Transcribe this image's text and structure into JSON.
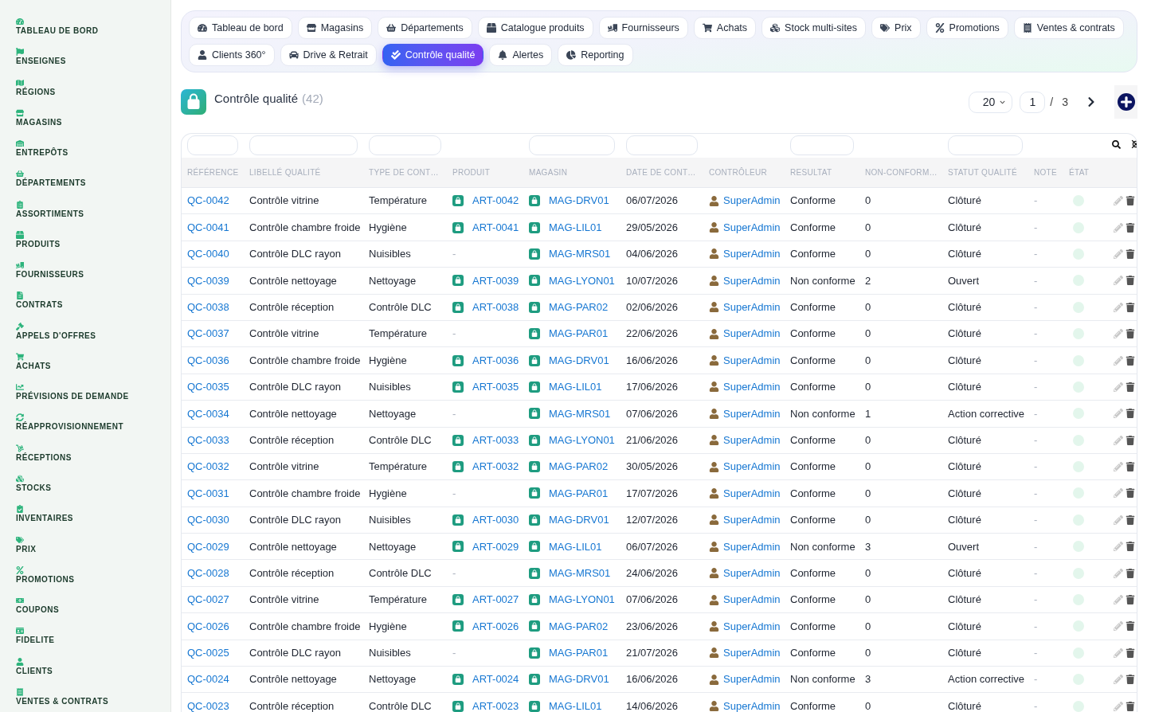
{
  "sidebar": {
    "items": [
      {
        "label": "TABLEAU DE BORD"
      },
      {
        "label": "ENSEIGNES"
      },
      {
        "label": "RÉGIONS"
      },
      {
        "label": "MAGASINS"
      },
      {
        "label": "ENTREPÔTS"
      },
      {
        "label": "DÉPARTEMENTS"
      },
      {
        "label": "ASSORTIMENTS"
      },
      {
        "label": "PRODUITS"
      },
      {
        "label": "FOURNISSEURS"
      },
      {
        "label": "CONTRATS"
      },
      {
        "label": "APPELS D'OFFRES"
      },
      {
        "label": "ACHATS"
      },
      {
        "label": "PRÉVISIONS DE DEMANDE"
      },
      {
        "label": "RÉAPPROVISIONNEMENT"
      },
      {
        "label": "RÉCEPTIONS"
      },
      {
        "label": "STOCKS"
      },
      {
        "label": "INVENTAIRES"
      },
      {
        "label": "PRIX"
      },
      {
        "label": "PROMOTIONS"
      },
      {
        "label": "COUPONS"
      },
      {
        "label": "FIDELITE"
      },
      {
        "label": "CLIENTS"
      },
      {
        "label": "VENTES & CONTRATS"
      }
    ]
  },
  "tab_rows": [
    [
      {
        "label": "Tableau de bord",
        "selected": false
      },
      {
        "label": "Magasins",
        "selected": false
      },
      {
        "label": "Départements",
        "selected": false
      },
      {
        "label": "Catalogue produits",
        "selected": false
      },
      {
        "label": "Fournisseurs",
        "selected": false
      },
      {
        "label": "Achats",
        "selected": false
      },
      {
        "label": "Stock multi-sites",
        "selected": false
      },
      {
        "label": "Prix",
        "selected": false
      },
      {
        "label": "Promotions",
        "selected": false
      },
      {
        "label": "Ventes & contrats",
        "selected": false
      }
    ],
    [
      {
        "label": "Clients 360°",
        "selected": false
      },
      {
        "label": "Drive & Retrait",
        "selected": false
      },
      {
        "label": "Contrôle qualité",
        "selected": true
      },
      {
        "label": "Alertes",
        "selected": false
      },
      {
        "label": "Reporting",
        "selected": false
      }
    ]
  ],
  "page_header": {
    "title": "Contrôle qualité",
    "count": "(42)"
  },
  "pagination": {
    "page_size": "20",
    "page": "1",
    "separator": "/",
    "total_pages": "3"
  },
  "table": {
    "columns": [
      {
        "label": "RÉFÉRENCE",
        "has_filter": true
      },
      {
        "label": "LIBELLÉ QUALITÉ",
        "has_filter": true
      },
      {
        "label": "TYPE DE CONT…",
        "has_filter": true
      },
      {
        "label": "PRODUIT",
        "has_filter": false
      },
      {
        "label": "MAGASIN",
        "has_filter": true
      },
      {
        "label": "DATE DE CONT…",
        "has_filter": true
      },
      {
        "label": "CONTRÔLEUR",
        "has_filter": false
      },
      {
        "label": "RESULTAT",
        "has_filter": true
      },
      {
        "label": "NON-CONFORM…",
        "has_filter": false
      },
      {
        "label": "STATUT QUALITÉ",
        "has_filter": true
      },
      {
        "label": "NOTE",
        "has_filter": false
      },
      {
        "label": "ÉTAT",
        "has_filter": false
      }
    ],
    "rows": [
      {
        "reference": "QC-0042",
        "libelle": "Contrôle vitrine",
        "type": "Température",
        "produit": {
          "kind": "link",
          "text": "ART-0042"
        },
        "magasin": "MAG-DRV01",
        "date": "06/07/2026",
        "controleur": "SuperAdmin",
        "resultat": "Conforme",
        "non_conformites": "0",
        "statut": "Clôturé",
        "note": "-"
      },
      {
        "reference": "QC-0041",
        "libelle": "Contrôle chambre froide",
        "type": "Hygiène",
        "produit": {
          "kind": "link",
          "text": "ART-0041"
        },
        "magasin": "MAG-LIL01",
        "date": "29/05/2026",
        "controleur": "SuperAdmin",
        "resultat": "Conforme",
        "non_conformites": "0",
        "statut": "Clôturé",
        "note": "-"
      },
      {
        "reference": "QC-0040",
        "libelle": "Contrôle DLC rayon",
        "type": "Nuisibles",
        "produit": {
          "kind": "empty",
          "text": "-"
        },
        "magasin": "MAG-MRS01",
        "date": "04/06/2026",
        "controleur": "SuperAdmin",
        "resultat": "Conforme",
        "non_conformites": "0",
        "statut": "Clôturé",
        "note": "-"
      },
      {
        "reference": "QC-0039",
        "libelle": "Contrôle nettoyage",
        "type": "Nettoyage",
        "produit": {
          "kind": "link",
          "text": "ART-0039"
        },
        "magasin": "MAG-LYON01",
        "date": "10/07/2026",
        "controleur": "SuperAdmin",
        "resultat": "Non conforme",
        "non_conformites": "2",
        "statut": "Ouvert",
        "note": "-"
      },
      {
        "reference": "QC-0038",
        "libelle": "Contrôle réception",
        "type": "Contrôle DLC",
        "produit": {
          "kind": "link",
          "text": "ART-0038"
        },
        "magasin": "MAG-PAR02",
        "date": "02/06/2026",
        "controleur": "SuperAdmin",
        "resultat": "Conforme",
        "non_conformites": "0",
        "statut": "Clôturé",
        "note": "-"
      },
      {
        "reference": "QC-0037",
        "libelle": "Contrôle vitrine",
        "type": "Température",
        "produit": {
          "kind": "empty",
          "text": "-"
        },
        "magasin": "MAG-PAR01",
        "date": "22/06/2026",
        "controleur": "SuperAdmin",
        "resultat": "Conforme",
        "non_conformites": "0",
        "statut": "Clôturé",
        "note": "-"
      },
      {
        "reference": "QC-0036",
        "libelle": "Contrôle chambre froide",
        "type": "Hygiène",
        "produit": {
          "kind": "link",
          "text": "ART-0036"
        },
        "magasin": "MAG-DRV01",
        "date": "16/06/2026",
        "controleur": "SuperAdmin",
        "resultat": "Conforme",
        "non_conformites": "0",
        "statut": "Clôturé",
        "note": "-"
      },
      {
        "reference": "QC-0035",
        "libelle": "Contrôle DLC rayon",
        "type": "Nuisibles",
        "produit": {
          "kind": "link",
          "text": "ART-0035"
        },
        "magasin": "MAG-LIL01",
        "date": "17/06/2026",
        "controleur": "SuperAdmin",
        "resultat": "Conforme",
        "non_conformites": "0",
        "statut": "Clôturé",
        "note": "-"
      },
      {
        "reference": "QC-0034",
        "libelle": "Contrôle nettoyage",
        "type": "Nettoyage",
        "produit": {
          "kind": "empty",
          "text": "-"
        },
        "magasin": "MAG-MRS01",
        "date": "07/06/2026",
        "controleur": "SuperAdmin",
        "resultat": "Non conforme",
        "non_conformites": "1",
        "statut": "Action corrective",
        "note": "-"
      },
      {
        "reference": "QC-0033",
        "libelle": "Contrôle réception",
        "type": "Contrôle DLC",
        "produit": {
          "kind": "link",
          "text": "ART-0033"
        },
        "magasin": "MAG-LYON01",
        "date": "21/06/2026",
        "controleur": "SuperAdmin",
        "resultat": "Conforme",
        "non_conformites": "0",
        "statut": "Clôturé",
        "note": "-"
      },
      {
        "reference": "QC-0032",
        "libelle": "Contrôle vitrine",
        "type": "Température",
        "produit": {
          "kind": "link",
          "text": "ART-0032"
        },
        "magasin": "MAG-PAR02",
        "date": "30/05/2026",
        "controleur": "SuperAdmin",
        "resultat": "Conforme",
        "non_conformites": "0",
        "statut": "Clôturé",
        "note": "-"
      },
      {
        "reference": "QC-0031",
        "libelle": "Contrôle chambre froide",
        "type": "Hygiène",
        "produit": {
          "kind": "empty",
          "text": "-"
        },
        "magasin": "MAG-PAR01",
        "date": "17/07/2026",
        "controleur": "SuperAdmin",
        "resultat": "Conforme",
        "non_conformites": "0",
        "statut": "Clôturé",
        "note": "-"
      },
      {
        "reference": "QC-0030",
        "libelle": "Contrôle DLC rayon",
        "type": "Nuisibles",
        "produit": {
          "kind": "link",
          "text": "ART-0030"
        },
        "magasin": "MAG-DRV01",
        "date": "12/07/2026",
        "controleur": "SuperAdmin",
        "resultat": "Conforme",
        "non_conformites": "0",
        "statut": "Clôturé",
        "note": "-"
      },
      {
        "reference": "QC-0029",
        "libelle": "Contrôle nettoyage",
        "type": "Nettoyage",
        "produit": {
          "kind": "link",
          "text": "ART-0029"
        },
        "magasin": "MAG-LIL01",
        "date": "06/07/2026",
        "controleur": "SuperAdmin",
        "resultat": "Non conforme",
        "non_conformites": "3",
        "statut": "Ouvert",
        "note": "-"
      },
      {
        "reference": "QC-0028",
        "libelle": "Contrôle réception",
        "type": "Contrôle DLC",
        "produit": {
          "kind": "empty",
          "text": "-"
        },
        "magasin": "MAG-MRS01",
        "date": "24/06/2026",
        "controleur": "SuperAdmin",
        "resultat": "Conforme",
        "non_conformites": "0",
        "statut": "Clôturé",
        "note": "-"
      },
      {
        "reference": "QC-0027",
        "libelle": "Contrôle vitrine",
        "type": "Température",
        "produit": {
          "kind": "link",
          "text": "ART-0027"
        },
        "magasin": "MAG-LYON01",
        "date": "07/06/2026",
        "controleur": "SuperAdmin",
        "resultat": "Conforme",
        "non_conformites": "0",
        "statut": "Clôturé",
        "note": "-"
      },
      {
        "reference": "QC-0026",
        "libelle": "Contrôle chambre froide",
        "type": "Hygiène",
        "produit": {
          "kind": "link",
          "text": "ART-0026"
        },
        "magasin": "MAG-PAR02",
        "date": "23/06/2026",
        "controleur": "SuperAdmin",
        "resultat": "Conforme",
        "non_conformites": "0",
        "statut": "Clôturé",
        "note": "-"
      },
      {
        "reference": "QC-0025",
        "libelle": "Contrôle DLC rayon",
        "type": "Nuisibles",
        "produit": {
          "kind": "empty",
          "text": "-"
        },
        "magasin": "MAG-PAR01",
        "date": "21/07/2026",
        "controleur": "SuperAdmin",
        "resultat": "Conforme",
        "non_conformites": "0",
        "statut": "Clôturé",
        "note": "-"
      },
      {
        "reference": "QC-0024",
        "libelle": "Contrôle nettoyage",
        "type": "Nettoyage",
        "produit": {
          "kind": "link",
          "text": "ART-0024"
        },
        "magasin": "MAG-DRV01",
        "date": "16/06/2026",
        "controleur": "SuperAdmin",
        "resultat": "Non conforme",
        "non_conformites": "3",
        "statut": "Action corrective",
        "note": "-"
      },
      {
        "reference": "QC-0023",
        "libelle": "Contrôle réception",
        "type": "Contrôle DLC",
        "produit": {
          "kind": "link",
          "text": "ART-0023"
        },
        "magasin": "MAG-LIL01",
        "date": "14/06/2026",
        "controleur": "SuperAdmin",
        "resultat": "Conforme",
        "non_conformites": "0",
        "statut": "Clôturé",
        "note": "-"
      }
    ]
  }
}
